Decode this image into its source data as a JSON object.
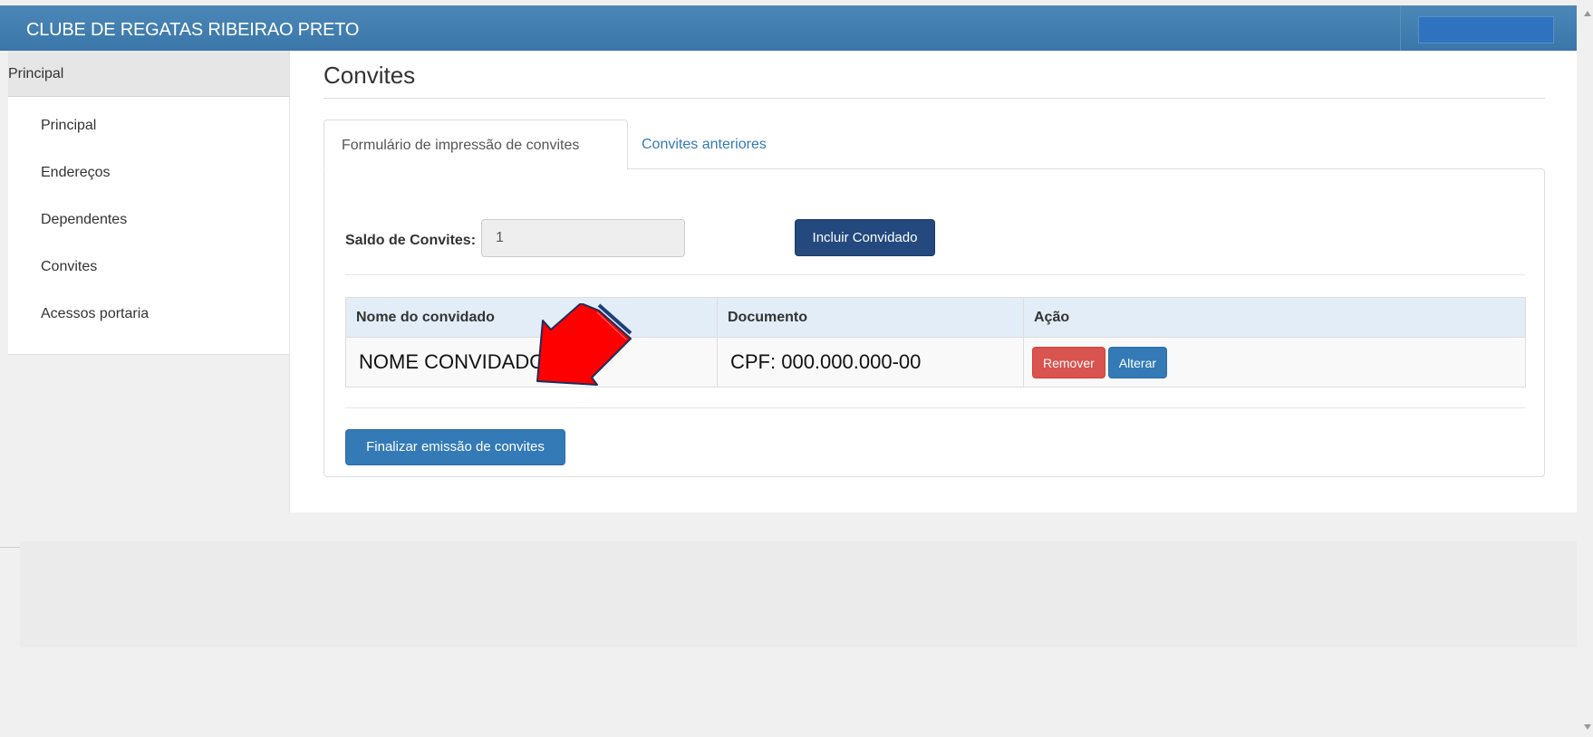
{
  "header": {
    "brand": "CLUBE DE REGATAS RIBEIRAO PRETO"
  },
  "sidebar": {
    "heading": "Principal",
    "items": [
      {
        "label": "Principal"
      },
      {
        "label": "Endereços"
      },
      {
        "label": "Dependentes"
      },
      {
        "label": "Convites"
      },
      {
        "label": "Acessos portaria"
      }
    ]
  },
  "main": {
    "title": "Convites",
    "tabs": [
      {
        "label": "Formulário de impressão de convites",
        "active": true
      },
      {
        "label": "Convites anteriores",
        "active": false
      }
    ],
    "saldo": {
      "label": "Saldo de Convites:",
      "value": "1"
    },
    "include_button": "Incluir Convidado",
    "table": {
      "headers": [
        "Nome do convidado",
        "Documento",
        "Ação"
      ],
      "rows": [
        {
          "nome": "NOME CONVIDADO",
          "documento": "CPF: 000.000.000-00",
          "remove_label": "Remover",
          "edit_label": "Alterar"
        }
      ]
    },
    "finalize_button": "Finalizar emissão de convites"
  },
  "annotation": {
    "icon": "red-arrow-icon",
    "color": "#ff0000"
  },
  "colors": {
    "header": "#3f7cae",
    "primary": "#337ab7",
    "dark_primary": "#23497f",
    "danger": "#d9534f",
    "table_head": "#e3edf7"
  }
}
